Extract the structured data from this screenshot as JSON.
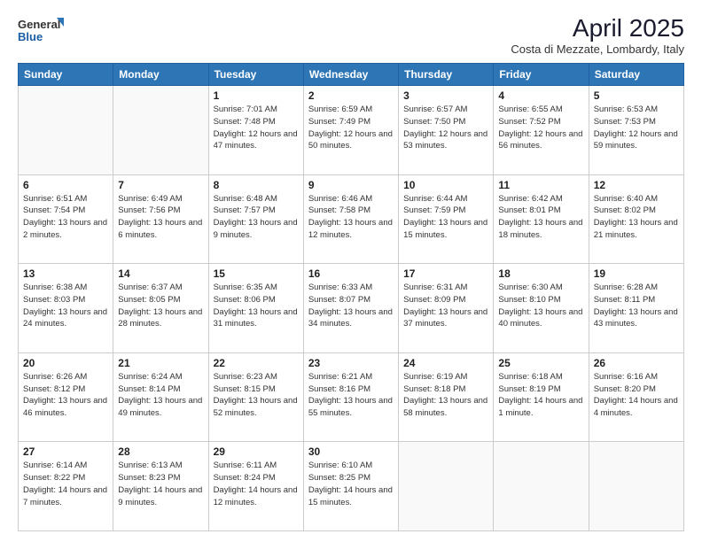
{
  "logo": {
    "general": "General",
    "blue": "Blue"
  },
  "title": "April 2025",
  "location": "Costa di Mezzate, Lombardy, Italy",
  "days_of_week": [
    "Sunday",
    "Monday",
    "Tuesday",
    "Wednesday",
    "Thursday",
    "Friday",
    "Saturday"
  ],
  "weeks": [
    [
      {
        "day": "",
        "info": ""
      },
      {
        "day": "",
        "info": ""
      },
      {
        "day": "1",
        "info": "Sunrise: 7:01 AM\nSunset: 7:48 PM\nDaylight: 12 hours\nand 47 minutes."
      },
      {
        "day": "2",
        "info": "Sunrise: 6:59 AM\nSunset: 7:49 PM\nDaylight: 12 hours\nand 50 minutes."
      },
      {
        "day": "3",
        "info": "Sunrise: 6:57 AM\nSunset: 7:50 PM\nDaylight: 12 hours\nand 53 minutes."
      },
      {
        "day": "4",
        "info": "Sunrise: 6:55 AM\nSunset: 7:52 PM\nDaylight: 12 hours\nand 56 minutes."
      },
      {
        "day": "5",
        "info": "Sunrise: 6:53 AM\nSunset: 7:53 PM\nDaylight: 12 hours\nand 59 minutes."
      }
    ],
    [
      {
        "day": "6",
        "info": "Sunrise: 6:51 AM\nSunset: 7:54 PM\nDaylight: 13 hours\nand 2 minutes."
      },
      {
        "day": "7",
        "info": "Sunrise: 6:49 AM\nSunset: 7:56 PM\nDaylight: 13 hours\nand 6 minutes."
      },
      {
        "day": "8",
        "info": "Sunrise: 6:48 AM\nSunset: 7:57 PM\nDaylight: 13 hours\nand 9 minutes."
      },
      {
        "day": "9",
        "info": "Sunrise: 6:46 AM\nSunset: 7:58 PM\nDaylight: 13 hours\nand 12 minutes."
      },
      {
        "day": "10",
        "info": "Sunrise: 6:44 AM\nSunset: 7:59 PM\nDaylight: 13 hours\nand 15 minutes."
      },
      {
        "day": "11",
        "info": "Sunrise: 6:42 AM\nSunset: 8:01 PM\nDaylight: 13 hours\nand 18 minutes."
      },
      {
        "day": "12",
        "info": "Sunrise: 6:40 AM\nSunset: 8:02 PM\nDaylight: 13 hours\nand 21 minutes."
      }
    ],
    [
      {
        "day": "13",
        "info": "Sunrise: 6:38 AM\nSunset: 8:03 PM\nDaylight: 13 hours\nand 24 minutes."
      },
      {
        "day": "14",
        "info": "Sunrise: 6:37 AM\nSunset: 8:05 PM\nDaylight: 13 hours\nand 28 minutes."
      },
      {
        "day": "15",
        "info": "Sunrise: 6:35 AM\nSunset: 8:06 PM\nDaylight: 13 hours\nand 31 minutes."
      },
      {
        "day": "16",
        "info": "Sunrise: 6:33 AM\nSunset: 8:07 PM\nDaylight: 13 hours\nand 34 minutes."
      },
      {
        "day": "17",
        "info": "Sunrise: 6:31 AM\nSunset: 8:09 PM\nDaylight: 13 hours\nand 37 minutes."
      },
      {
        "day": "18",
        "info": "Sunrise: 6:30 AM\nSunset: 8:10 PM\nDaylight: 13 hours\nand 40 minutes."
      },
      {
        "day": "19",
        "info": "Sunrise: 6:28 AM\nSunset: 8:11 PM\nDaylight: 13 hours\nand 43 minutes."
      }
    ],
    [
      {
        "day": "20",
        "info": "Sunrise: 6:26 AM\nSunset: 8:12 PM\nDaylight: 13 hours\nand 46 minutes."
      },
      {
        "day": "21",
        "info": "Sunrise: 6:24 AM\nSunset: 8:14 PM\nDaylight: 13 hours\nand 49 minutes."
      },
      {
        "day": "22",
        "info": "Sunrise: 6:23 AM\nSunset: 8:15 PM\nDaylight: 13 hours\nand 52 minutes."
      },
      {
        "day": "23",
        "info": "Sunrise: 6:21 AM\nSunset: 8:16 PM\nDaylight: 13 hours\nand 55 minutes."
      },
      {
        "day": "24",
        "info": "Sunrise: 6:19 AM\nSunset: 8:18 PM\nDaylight: 13 hours\nand 58 minutes."
      },
      {
        "day": "25",
        "info": "Sunrise: 6:18 AM\nSunset: 8:19 PM\nDaylight: 14 hours\nand 1 minute."
      },
      {
        "day": "26",
        "info": "Sunrise: 6:16 AM\nSunset: 8:20 PM\nDaylight: 14 hours\nand 4 minutes."
      }
    ],
    [
      {
        "day": "27",
        "info": "Sunrise: 6:14 AM\nSunset: 8:22 PM\nDaylight: 14 hours\nand 7 minutes."
      },
      {
        "day": "28",
        "info": "Sunrise: 6:13 AM\nSunset: 8:23 PM\nDaylight: 14 hours\nand 9 minutes."
      },
      {
        "day": "29",
        "info": "Sunrise: 6:11 AM\nSunset: 8:24 PM\nDaylight: 14 hours\nand 12 minutes."
      },
      {
        "day": "30",
        "info": "Sunrise: 6:10 AM\nSunset: 8:25 PM\nDaylight: 14 hours\nand 15 minutes."
      },
      {
        "day": "",
        "info": ""
      },
      {
        "day": "",
        "info": ""
      },
      {
        "day": "",
        "info": ""
      }
    ]
  ]
}
